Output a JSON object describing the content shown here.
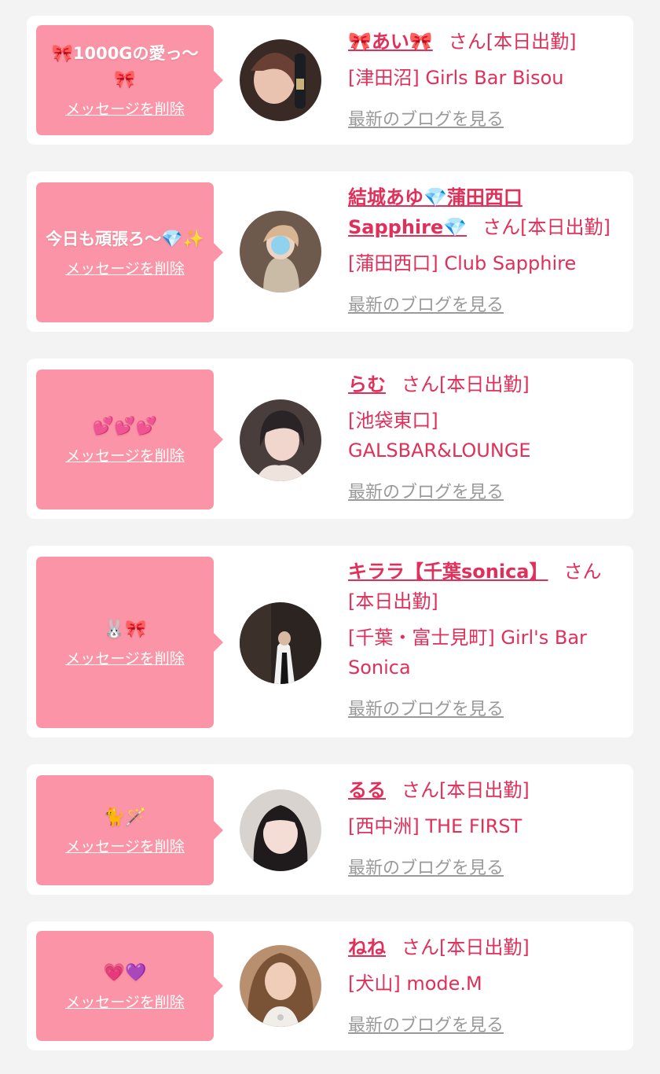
{
  "colors": {
    "background": "#f3f3f3",
    "card": "#ffffff",
    "bubble": "#fb94a6",
    "accent": "#e0305a",
    "blog_link": "#9a9a9a"
  },
  "cards": [
    {
      "message": "1000Gの愛っ〜",
      "message_emoji_lead": "🎀",
      "message_emoji_tail": "🎀",
      "delete_label": "メッセージを削除",
      "name": "🎀あい🎀",
      "suffix": "さん[本日出勤]",
      "shop": "[津田沼] Girls Bar Bisou",
      "blog_label": "最新のブログを見る"
    },
    {
      "message": "今日も頑張ろ〜",
      "message_emoji_lead": "",
      "message_emoji_tail": "💎✨",
      "delete_label": "メッセージを削除",
      "name": "結城あゆ💎蒲田西口Sapphire💎",
      "suffix": "さん[本日出勤]",
      "shop": "[蒲田西口] Club Sapphire",
      "blog_label": "最新のブログを見る"
    },
    {
      "message": "",
      "message_emoji_lead": "",
      "message_emoji_tail": "💕💕💕",
      "delete_label": "メッセージを削除",
      "name": "らむ",
      "suffix": "さん[本日出勤]",
      "shop": "[池袋東口] GALSBAR&LOUNGE",
      "blog_label": "最新のブログを見る"
    },
    {
      "message": "",
      "message_emoji_lead": "",
      "message_emoji_tail": "🐰🎀",
      "delete_label": "メッセージを削除",
      "name": "キララ【千葉sonica】",
      "suffix": "さん[本日出勤]",
      "shop": "[千葉・富士見町] Girl's Bar Sonica",
      "blog_label": "最新のブログを見る"
    },
    {
      "message": "",
      "message_emoji_lead": "",
      "message_emoji_tail": "🐈🪄",
      "delete_label": "メッセージを削除",
      "name": "るる",
      "suffix": "さん[本日出勤]",
      "shop": "[西中洲] THE FIRST",
      "blog_label": "最新のブログを見る"
    },
    {
      "message": "",
      "message_emoji_lead": "",
      "message_emoji_tail": "💗💜",
      "delete_label": "メッセージを削除",
      "name": "ねね",
      "suffix": "さん[本日出勤]",
      "shop": "[犬山] mode.M",
      "blog_label": "最新のブログを見る"
    }
  ]
}
